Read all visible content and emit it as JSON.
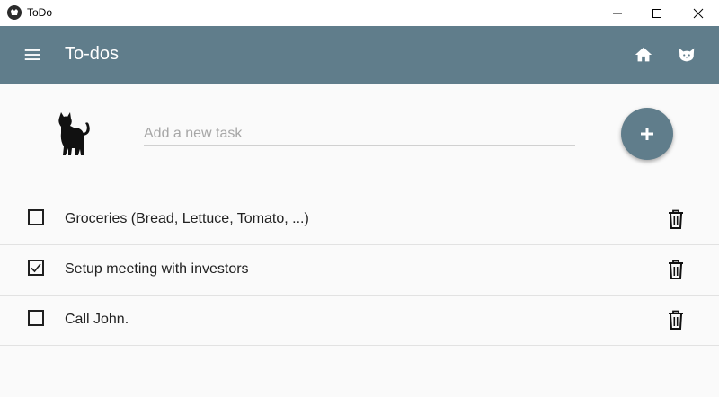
{
  "window": {
    "title": "ToDo",
    "icon": "app-logo-icon",
    "controls": [
      "minimize-icon",
      "maximize-icon",
      "close-icon"
    ]
  },
  "toolbar": {
    "title": "To-dos",
    "background": "#607d8b",
    "left_icon": "menu-icon",
    "right_icons": [
      "home-icon",
      "cat-face-icon"
    ]
  },
  "new_task": {
    "logo_icon": "black-cat-icon",
    "placeholder": "Add a new task",
    "value": "",
    "add_icon": "plus-icon"
  },
  "tasks": [
    {
      "label": "Groceries (Bread, Lettuce, Tomato, ...)",
      "checked": false,
      "delete_icon": "trash-icon"
    },
    {
      "label": "Setup meeting with investors",
      "checked": true,
      "delete_icon": "trash-icon"
    },
    {
      "label": "Call John.",
      "checked": false,
      "delete_icon": "trash-icon"
    }
  ],
  "colors": {
    "accent": "#607d8b",
    "background": "#fafafa",
    "text": "#212121"
  }
}
